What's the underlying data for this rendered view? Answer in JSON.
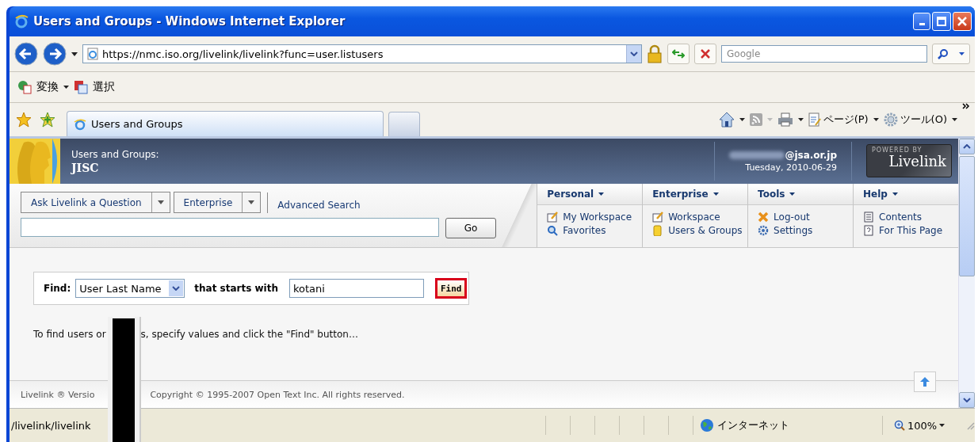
{
  "window": {
    "title": "Users and Groups - Windows Internet Explorer"
  },
  "address_bar": {
    "url": "https://nmc.iso.org/livelink/livelink?func=user.listusers"
  },
  "search_box": {
    "placeholder": "Google"
  },
  "links_bar": [
    {
      "label": "変換",
      "dropdown": true
    },
    {
      "label": "選択",
      "dropdown": false
    }
  ],
  "tabs": [
    {
      "label": "Users and Groups",
      "selected": true
    }
  ],
  "command_bar": [
    {
      "label": "ページ(P)",
      "kind": "page"
    },
    {
      "label": "ツール(O)",
      "kind": "tools"
    }
  ],
  "header": {
    "title": "Users and Groups:",
    "subtitle": "JISC",
    "user_email": "@jsa.or.jp",
    "date": "Tuesday, 2010-06-29",
    "powered_by": "POWERED BY",
    "brand": "Livelink"
  },
  "search": {
    "scope_menus": [
      "Ask Livelink a Question",
      "Enterprise"
    ],
    "advanced_link": "Advanced Search",
    "go_button": "Go"
  },
  "menus": [
    {
      "title": "Personal",
      "items": [
        "My Workspace",
        "Favorites"
      ]
    },
    {
      "title": "Enterprise",
      "items": [
        "Workspace",
        "Users & Groups"
      ]
    },
    {
      "title": "Tools",
      "items": [
        "Log-out",
        "Settings"
      ]
    },
    {
      "title": "Help",
      "items": [
        "Contents",
        "For This Page"
      ]
    }
  ],
  "find": {
    "label": "Find:",
    "field": "User Last Name",
    "condition": "that starts with",
    "value": "kotani",
    "button": "Find"
  },
  "message": [
    "To find users or",
    "s, specify values and click the \"Find\" button…"
  ],
  "footer": [
    "Livelink ® Versio",
    "Copyright © 1995-2007 Open Text Inc. All rights reserved."
  ],
  "status_bar": {
    "text": "/livelink/livelink",
    "zone": "インターネット",
    "zoom": "100%"
  }
}
